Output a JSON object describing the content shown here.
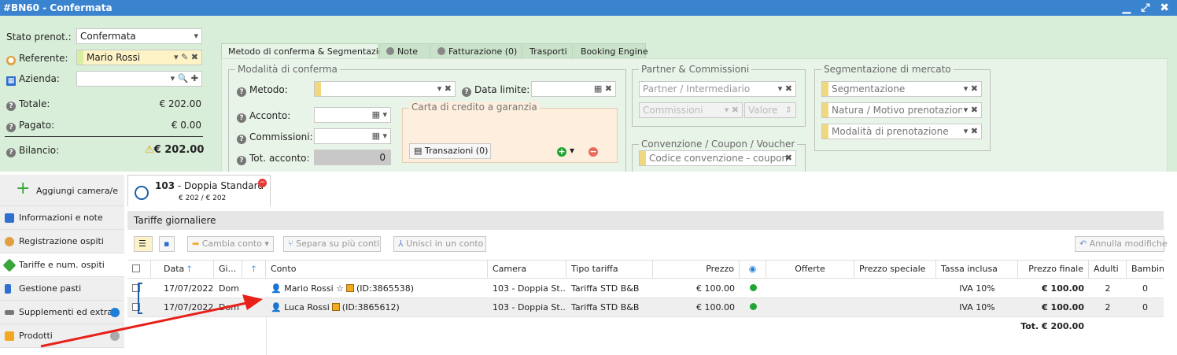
{
  "window": {
    "title": "#BN60 - Confermata",
    "controls": "▁ ⤢ ✖"
  },
  "summary": {
    "stato_label": "Stato prenot.:",
    "stato_value": "Confermata",
    "referente_label": "Referente:",
    "referente_value": "Mario Rossi",
    "azienda_label": "Azienda:",
    "azienda_value": "",
    "totale_label": "Totale:",
    "totale_value": "€ 202.00",
    "pagato_label": "Pagato:",
    "pagato_value": "€ 0.00",
    "bilancio_label": "Bilancio:",
    "bilancio_value": "€ 202.00"
  },
  "tabs": [
    {
      "label": "Metodo di conferma & Segmentazione"
    },
    {
      "label": "Note"
    },
    {
      "label": "Fatturazione (0)"
    },
    {
      "label": "Trasporti"
    },
    {
      "label": "Booking Engine"
    }
  ],
  "modalita": {
    "title": "Modalità di conferma",
    "metodo_label": "Metodo:",
    "metodo_value": "",
    "data_limite_label": "Data limite:",
    "data_limite_value": "",
    "acconto_label": "Acconto:",
    "commissioni_label": "Commissioni:",
    "tot_acconto_label": "Tot. acconto:",
    "tot_acconto_value": "0",
    "carta_title": "Carta di credito a garanzia",
    "transazioni_label": "Transazioni (0)"
  },
  "partner": {
    "title": "Partner & Commissioni",
    "partner_placeholder": "Partner / Intermediario",
    "commissioni_placeholder": "Commissioni",
    "valore_placeholder": "Valore",
    "convenzione_title": "Convenzione / Coupon / Voucher",
    "codice_placeholder": "Codice convenzione - coupon"
  },
  "segmentazione": {
    "title": "Segmentazione di mercato",
    "seg_placeholder": "Segmentazione",
    "natura_placeholder": "Natura / Motivo prenotazion",
    "modalita_placeholder": "Modalità di prenotazione"
  },
  "nav": {
    "add_room": "Aggiungi camera/e",
    "items": [
      {
        "label": "Informazioni e note"
      },
      {
        "label": "Registrazione ospiti"
      },
      {
        "label": "Tariffe e num. ospiti"
      },
      {
        "label": "Gestione pasti"
      },
      {
        "label": "Supplementi ed extra"
      },
      {
        "label": "Prodotti"
      }
    ]
  },
  "room_tab": {
    "number": "103",
    "name": " - Doppia Standard",
    "price": "€ 202 / € 202"
  },
  "tariffe": {
    "section_title": "Tariffe giornaliere",
    "toolbar": {
      "cambia_conto": "Cambia conto",
      "separa": "Separa su più conti",
      "unisci": "Unisci in un conto",
      "annulla": "Annulla modifiche"
    },
    "columns": [
      "Data",
      "Gi...",
      "",
      "Conto",
      "Camera",
      "Tipo tariffa",
      "Prezzo",
      "",
      "Offerte",
      "Prezzo speciale",
      "Tassa inclusa",
      "Prezzo finale",
      "Adulti",
      "Bambini"
    ],
    "rows": [
      {
        "data": "17/07/2022",
        "giorno": "Dom",
        "conto": "Mario Rossi ☆",
        "conto_id": "(ID:3865538)",
        "camera": "103 - Doppia St...",
        "tipo": "Tariffa STD B&B",
        "prezzo": "€ 100.00",
        "tassa": "IVA 10%",
        "finale": "€ 100.00",
        "adulti": "2",
        "bambini": "0"
      },
      {
        "data": "17/07/2022",
        "giorno": "Dom",
        "conto": "Luca Rossi",
        "conto_id": "(ID:3865612)",
        "camera": "103 - Doppia St...",
        "tipo": "Tariffa STD B&B",
        "prezzo": "€ 100.00",
        "tassa": "IVA 10%",
        "finale": "€ 100.00",
        "adulti": "2",
        "bambini": "0"
      }
    ],
    "total": "Tot. € 200.00"
  },
  "colors": {
    "titlebar": "#3a83cf",
    "topzone": "#d8eed8",
    "accent_blue": "#1f7fd6",
    "arrow": "#e8201a",
    "status_green": "#21a635"
  }
}
